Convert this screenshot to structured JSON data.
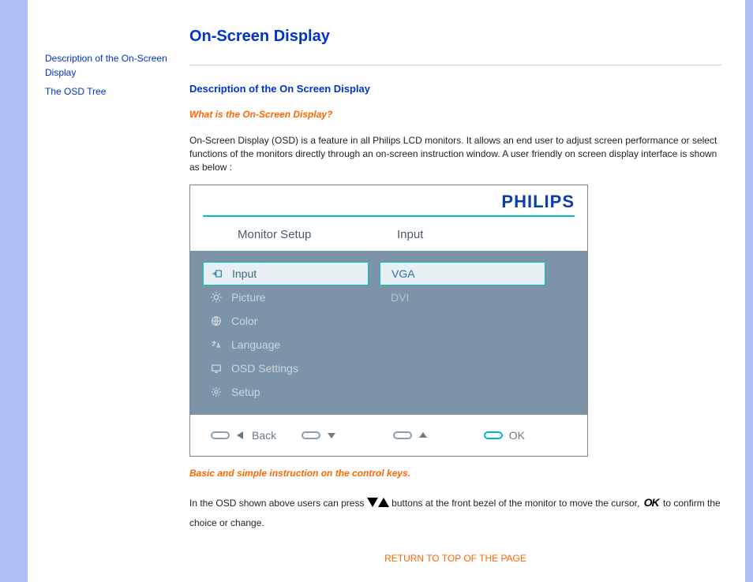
{
  "sidebar": {
    "links": [
      "Description of the On-Screen Display",
      "The OSD Tree"
    ]
  },
  "page": {
    "title": "On-Screen Display",
    "section_head": "Description of the On Screen Display",
    "question": "What is the On-Screen Display?",
    "intro": "On-Screen Display (OSD) is a feature in all Philips LCD monitors. It allows an end user to adjust screen performance or select functions of the monitors directly through an on-screen instruction window. A user friendly on screen display interface is shown as below :",
    "orange_head2": "Basic and simple instruction on the control keys.",
    "instr_part1": "In the OSD shown above users can press",
    "instr_part2": "buttons at the front bezel of the monitor to move the cursor,",
    "instr_part3": "to confirm the choice or change.",
    "ok_label": "OK",
    "return_link": "RETURN TO TOP OF THE PAGE"
  },
  "osd": {
    "brand": "PHILIPS",
    "header_left": "Monitor Setup",
    "header_right": "Input",
    "menu": [
      {
        "label": "Input",
        "icon": "input",
        "selected": true
      },
      {
        "label": "Picture",
        "icon": "bright",
        "selected": false
      },
      {
        "label": "Color",
        "icon": "globe",
        "selected": false
      },
      {
        "label": "Language",
        "icon": "lang",
        "selected": false
      },
      {
        "label": "OSD Settings",
        "icon": "screen",
        "selected": false
      },
      {
        "label": "Setup",
        "icon": "gear",
        "selected": false
      }
    ],
    "submenu": [
      {
        "label": "VGA",
        "selected": true
      },
      {
        "label": "DVI",
        "selected": false
      }
    ],
    "nav": {
      "back": "Back",
      "ok": "OK"
    }
  }
}
